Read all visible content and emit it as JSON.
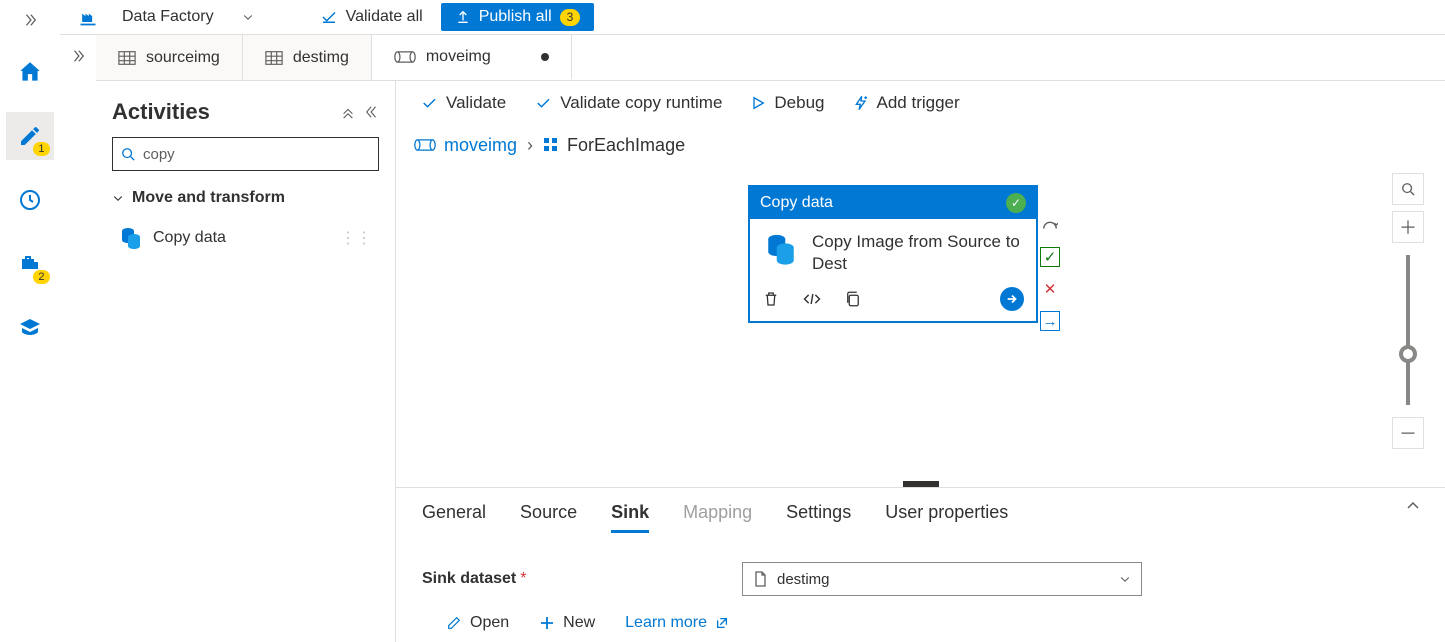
{
  "top": {
    "app_label": "Data Factory",
    "validate_all": "Validate all",
    "publish_all": "Publish all",
    "publish_count": "3"
  },
  "nav": {
    "badges": {
      "author": "1",
      "manage": "2"
    }
  },
  "tabs": [
    {
      "label": "sourceimg"
    },
    {
      "label": "destimg"
    },
    {
      "label": "moveimg",
      "active": true,
      "dirty": true
    }
  ],
  "activities": {
    "title": "Activities",
    "search_value": "copy",
    "group": "Move and transform",
    "items": [
      {
        "label": "Copy data"
      }
    ]
  },
  "canvas_toolbar": {
    "validate": "Validate",
    "validate_copy": "Validate copy runtime",
    "debug": "Debug",
    "add_trigger": "Add trigger"
  },
  "breadcrumb": {
    "root": "moveimg",
    "current": "ForEachImage"
  },
  "node": {
    "type": "Copy data",
    "name": "Copy Image from Source to Dest"
  },
  "details": {
    "tabs": [
      "General",
      "Source",
      "Sink",
      "Mapping",
      "Settings",
      "User properties"
    ],
    "active_tab": "Sink",
    "sink_label": "Sink dataset",
    "sink_value": "destimg",
    "open": "Open",
    "new": "New",
    "learn": "Learn more"
  }
}
